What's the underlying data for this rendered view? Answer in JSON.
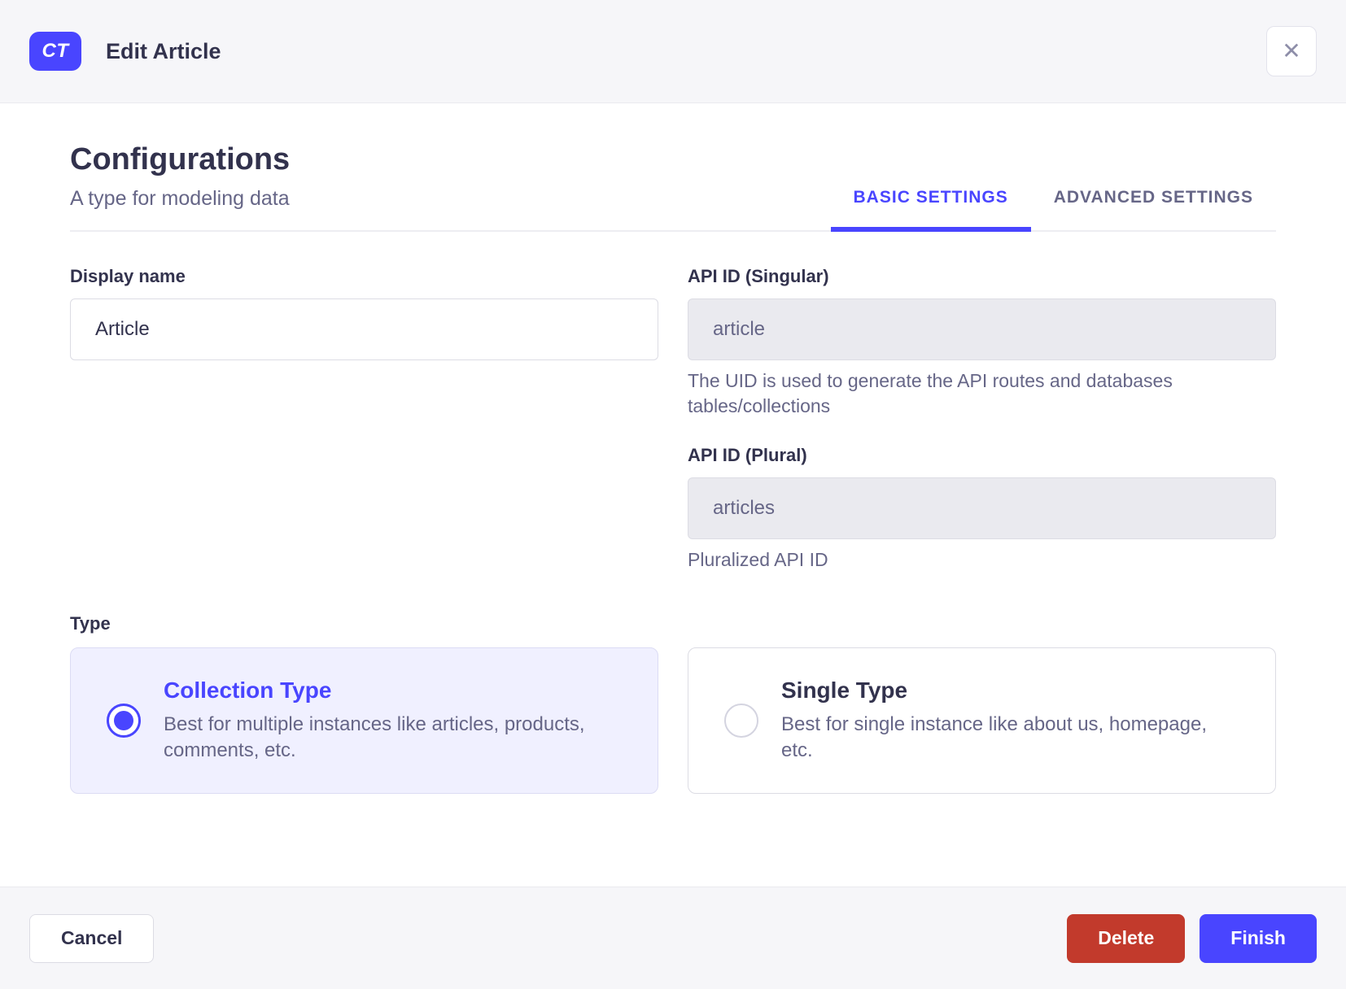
{
  "modal": {
    "badge": "CT",
    "title": "Edit Article"
  },
  "icons": {
    "close": "✕"
  },
  "configurations": {
    "title": "Configurations",
    "subtitle": "A type for modeling data"
  },
  "tabs": [
    {
      "label": "BASIC SETTINGS",
      "active": true
    },
    {
      "label": "ADVANCED SETTINGS",
      "active": false
    }
  ],
  "fields": {
    "display_name": {
      "label": "Display name",
      "value": "Article"
    },
    "api_id_singular": {
      "label": "API ID (Singular)",
      "value": "article",
      "hint": "The UID is used to generate the API routes and databases tables/collections"
    },
    "api_id_plural": {
      "label": "API ID (Plural)",
      "value": "articles",
      "hint": "Pluralized API ID"
    }
  },
  "type": {
    "label": "Type",
    "options": [
      {
        "title": "Collection Type",
        "description": "Best for multiple instances like articles, products, comments, etc.",
        "selected": true
      },
      {
        "title": "Single Type",
        "description": "Best for single instance like about us, homepage, etc.",
        "selected": false
      }
    ]
  },
  "footer": {
    "cancel": "Cancel",
    "delete": "Delete",
    "finish": "Finish"
  },
  "colors": {
    "primary": "#4945ff",
    "primary_background": "#f0f0ff",
    "danger": "#c23a2c",
    "text_dark": "#32324d",
    "text_gray": "#666687",
    "surface_gray": "#f6f6f9"
  }
}
